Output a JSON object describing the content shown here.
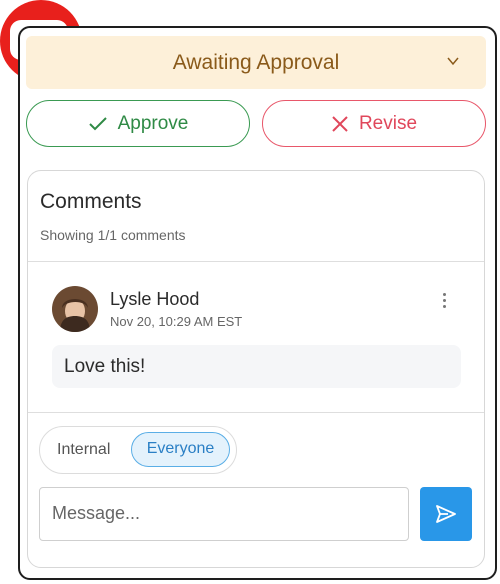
{
  "overlay": {
    "icon": "youtube-logo-icon",
    "color": "#e8201c"
  },
  "status": {
    "label": "Awaiting Approval",
    "icon": "chevron-down-icon",
    "bg": "#fdf0d9",
    "color": "#8a5a1a"
  },
  "actions": {
    "approve_label": "Approve",
    "approve_icon": "check-icon",
    "approve_color": "#2f8a45",
    "revise_label": "Revise",
    "revise_icon": "x-icon",
    "revise_color": "#e0475b"
  },
  "comments": {
    "title": "Comments",
    "count_text": "Showing 1/1 comments",
    "items": [
      {
        "author": "Lysle Hood",
        "timestamp": "Nov 20, 10:29 AM EST",
        "text": "Love this!",
        "menu_icon": "more-vertical-icon"
      }
    ]
  },
  "visibility": {
    "options": [
      "Internal",
      "Everyone"
    ],
    "selected": "Everyone",
    "accent": "#2a7fc5"
  },
  "composer": {
    "placeholder": "Message...",
    "send_icon": "send-icon",
    "send_color": "#2997e8"
  }
}
